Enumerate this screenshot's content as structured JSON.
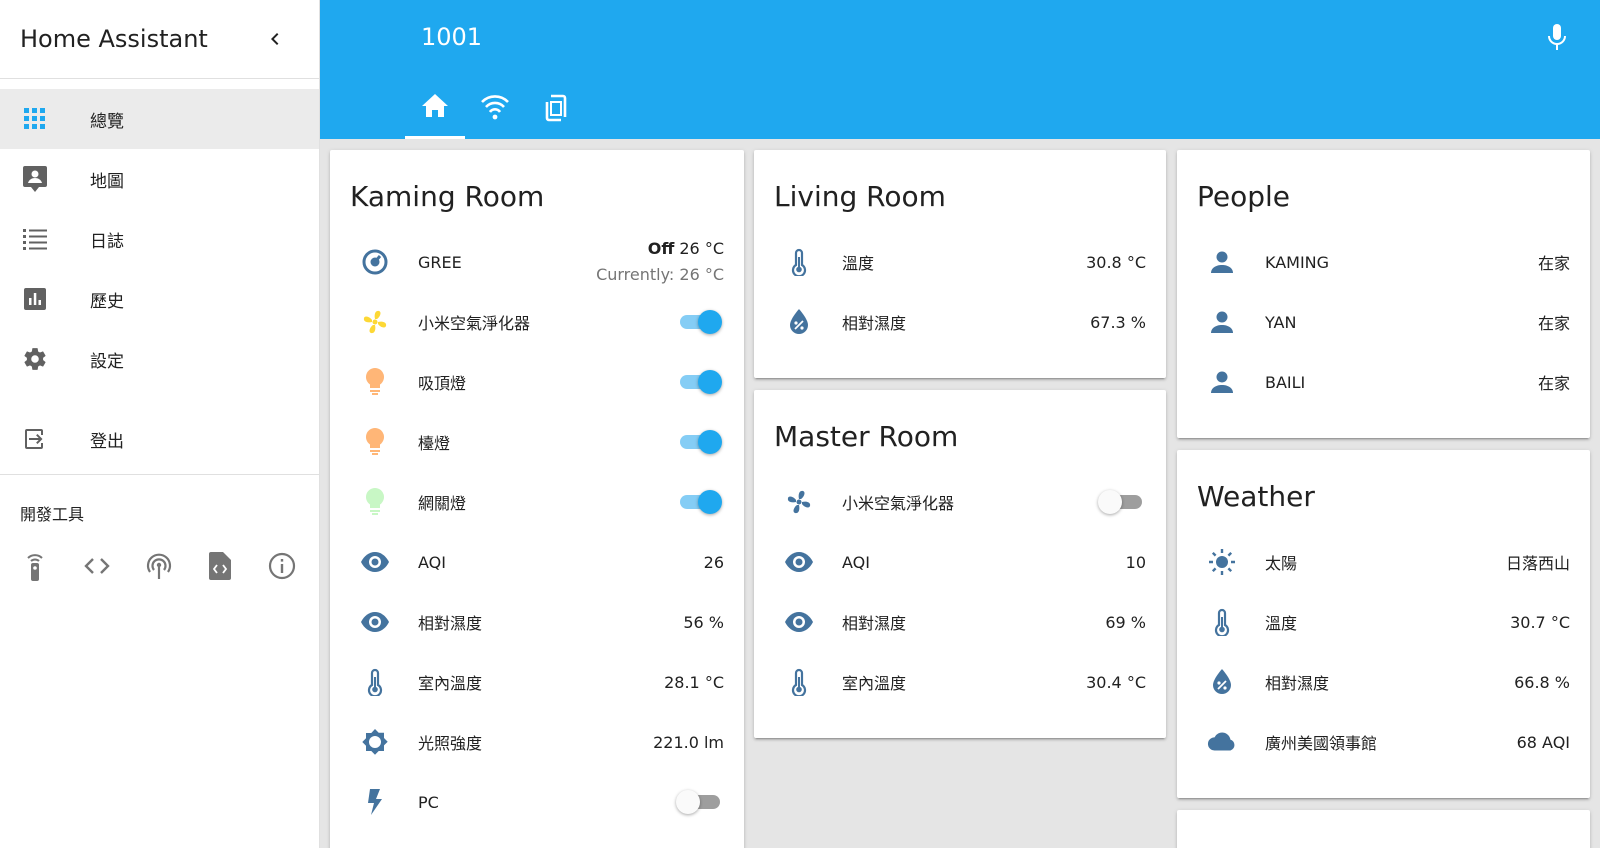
{
  "sidebar": {
    "title": "Home Assistant",
    "items": [
      {
        "label": "總覽",
        "icon": "view-dashboard-icon"
      },
      {
        "label": "地圖",
        "icon": "map-account-icon"
      },
      {
        "label": "日誌",
        "icon": "format-list-bulleted-icon"
      },
      {
        "label": "歷史",
        "icon": "chart-box-icon"
      },
      {
        "label": "設定",
        "icon": "cog-icon"
      }
    ],
    "logout_label": "登出",
    "dev_tools_title": "開發工具",
    "dev_tools": [
      "remote-icon",
      "code-tags-icon",
      "radio-tower-icon",
      "file-code-icon",
      "information-outline-icon"
    ]
  },
  "header": {
    "title": "1001",
    "tabs": [
      "home-icon",
      "wifi-icon",
      "tablet-icon"
    ],
    "accent_color": "#1fa8ef"
  },
  "kaming_room": {
    "title": "Kaming Room",
    "climate": {
      "name": "GREE",
      "state": "Off",
      "target": "26 °C",
      "current": "Currently: 26 °C"
    },
    "switches": [
      {
        "name": "小米空氣淨化器",
        "state": "on",
        "icon": "fan-icon",
        "icon_color": "#fdd835"
      },
      {
        "name": "吸頂燈",
        "state": "on",
        "icon": "lightbulb-icon",
        "icon_color": "#ffb677"
      },
      {
        "name": "檯燈",
        "state": "on",
        "icon": "lightbulb-icon",
        "icon_color": "#ffb677"
      },
      {
        "name": "網關燈",
        "state": "on",
        "icon": "lightbulb-icon",
        "icon_color": "#c8f7c5"
      }
    ],
    "sensors": [
      {
        "name": "AQI",
        "value": "26",
        "icon": "eye-icon"
      },
      {
        "name": "相對濕度",
        "value": "56 %",
        "icon": "eye-icon"
      },
      {
        "name": "室內溫度",
        "value": "28.1 °C",
        "icon": "thermometer-icon"
      },
      {
        "name": "光照強度",
        "value": "221.0 lm",
        "icon": "brightness-icon"
      }
    ],
    "pc": {
      "name": "PC",
      "state": "off",
      "icon": "flash-icon"
    }
  },
  "living_room": {
    "title": "Living Room",
    "sensors": [
      {
        "name": "溫度",
        "value": "30.8 °C",
        "icon": "thermometer-icon"
      },
      {
        "name": "相對濕度",
        "value": "67.3 %",
        "icon": "water-percent-icon"
      }
    ]
  },
  "master_room": {
    "title": "Master Room",
    "switch": {
      "name": "小米空氣淨化器",
      "state": "off",
      "icon": "fan-icon"
    },
    "sensors": [
      {
        "name": "AQI",
        "value": "10",
        "icon": "eye-icon"
      },
      {
        "name": "相對濕度",
        "value": "69 %",
        "icon": "eye-icon"
      },
      {
        "name": "室內溫度",
        "value": "30.4 °C",
        "icon": "thermometer-icon"
      }
    ]
  },
  "people": {
    "title": "People",
    "items": [
      {
        "name": "KAMING",
        "state": "在家"
      },
      {
        "name": "YAN",
        "state": "在家"
      },
      {
        "name": "BAILI",
        "state": "在家"
      }
    ]
  },
  "weather": {
    "title": "Weather",
    "items": [
      {
        "name": "太陽",
        "value": "日落西山",
        "icon": "white-balance-sunny-icon"
      },
      {
        "name": "溫度",
        "value": "30.7 °C",
        "icon": "thermometer-icon"
      },
      {
        "name": "相對濕度",
        "value": "66.8 %",
        "icon": "water-percent-icon"
      },
      {
        "name": "廣州美國領事館",
        "value": "68 AQI",
        "icon": "cloud-icon"
      }
    ]
  },
  "colors": {
    "icon_blue": "#44739e",
    "sidebar_active_icon": "#1fa8ef",
    "toggle_on": "#1fa8ef",
    "background": "#e5e5e5"
  }
}
